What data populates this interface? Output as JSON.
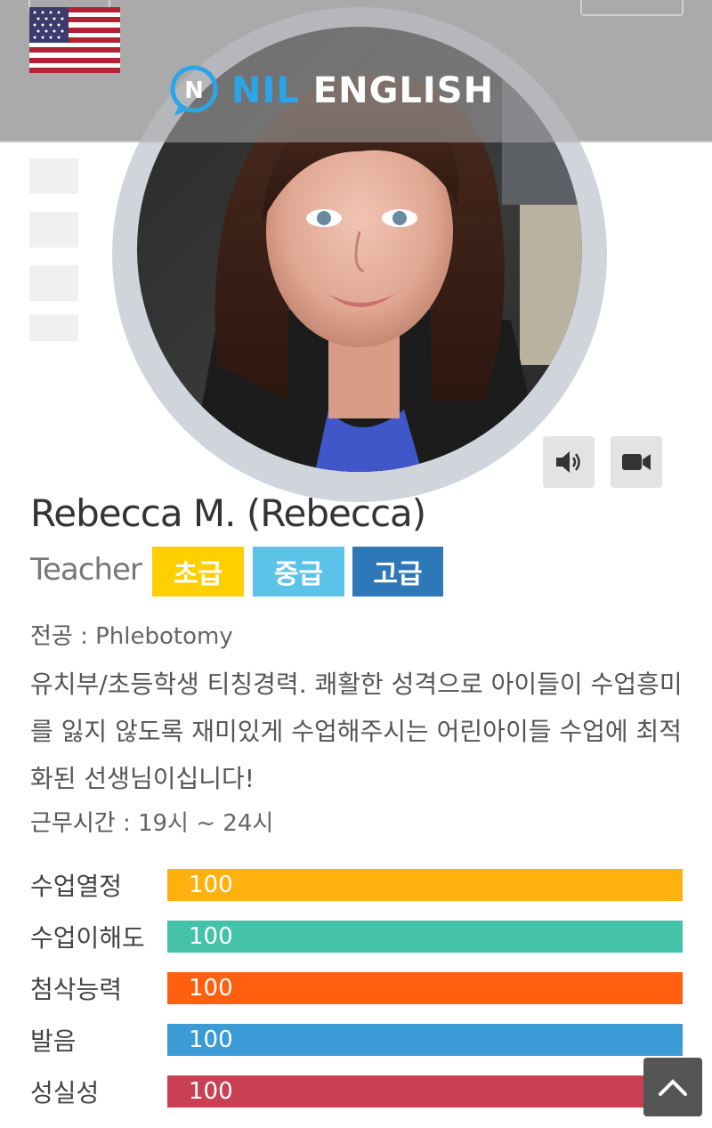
{
  "header": {
    "logo_prefix": "NIL",
    "logo_suffix": "ENGLISH",
    "flag_icon": "us-flag-icon"
  },
  "teacher": {
    "name": "Rebecca M. (Rebecca)",
    "role": "Teacher",
    "levels": [
      "초급",
      "중급",
      "고급"
    ],
    "major_label": "전공",
    "major_value": " : Phlebotomy",
    "description": "유치부/초등학생 티칭경력. 쾌활한 성격으로 아이들이 수업흥미를 잃지 않도록 재미있게 수업해주시는 어린아이들 수업에 최적화된 선생님이십니다!",
    "hours_label": "근무시간",
    "hours_value": " : 19시 ~ 24시"
  },
  "media": {
    "audio_icon": "speaker-icon",
    "video_icon": "video-camera-icon"
  },
  "stats": [
    {
      "label": "수업열정",
      "value": 100,
      "display": "100",
      "color": "#ffb20f"
    },
    {
      "label": "수업이해도",
      "value": 100,
      "display": "100",
      "color": "#45c2aa"
    },
    {
      "label": "첨삭능력",
      "value": 100,
      "display": "100",
      "color": "#ff5f0f"
    },
    {
      "label": "발음",
      "value": 100,
      "display": "100",
      "color": "#3a9bd6"
    },
    {
      "label": "성실성",
      "value": 100,
      "display": "100",
      "color": "#c94054"
    }
  ],
  "colors": {
    "header_bg": "#aaaaaa",
    "badge_beginner": "#ffcf00",
    "badge_intermediate": "#5cc3e8",
    "badge_advanced": "#2f78b7"
  }
}
